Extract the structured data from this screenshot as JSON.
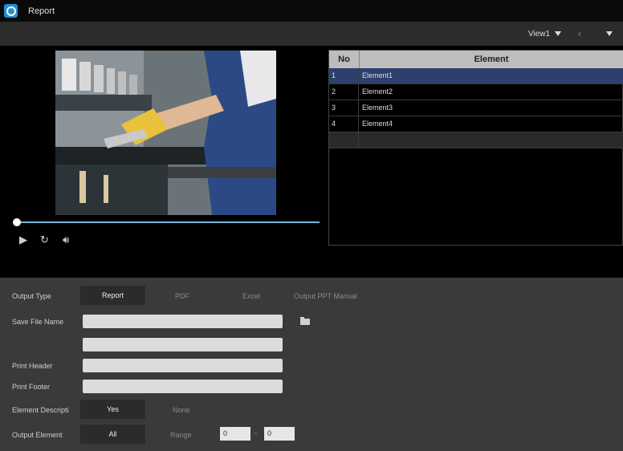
{
  "titlebar": {
    "title": "Report"
  },
  "toolbar": {
    "view": "View1",
    "prev": "‹"
  },
  "player": {
    "progress": 0.0,
    "play_icon": "play-icon",
    "replay_icon": "replay-icon",
    "volume_icon": "volume-icon"
  },
  "grid": {
    "headers": {
      "no": "No",
      "element": "Element"
    },
    "rows": [
      {
        "no": "1",
        "element": "Element1"
      },
      {
        "no": "2",
        "element": "Element2"
      },
      {
        "no": "3",
        "element": "Element3"
      },
      {
        "no": "4",
        "element": "Element4"
      }
    ]
  },
  "settings": {
    "output_type_label": "Output Type",
    "output_types": [
      "Report",
      "PDF",
      "Excel",
      "Output PPT Manual"
    ],
    "save_file_name_label": "Save File Name",
    "print_header_label": "Print Header",
    "print_footer_label": "Print Footer",
    "element_description_label": "Element Descripti",
    "element_description_options": [
      "Yes",
      "None"
    ],
    "output_element_label": "Output Element",
    "output_element_options": [
      "All",
      "Range"
    ],
    "range_from": "0",
    "range_sep": "~",
    "range_to": "0"
  },
  "colors": {
    "accent": "#1e8fd8",
    "selected_row": "#2e3f6e",
    "panel": "#3a3a3a"
  }
}
